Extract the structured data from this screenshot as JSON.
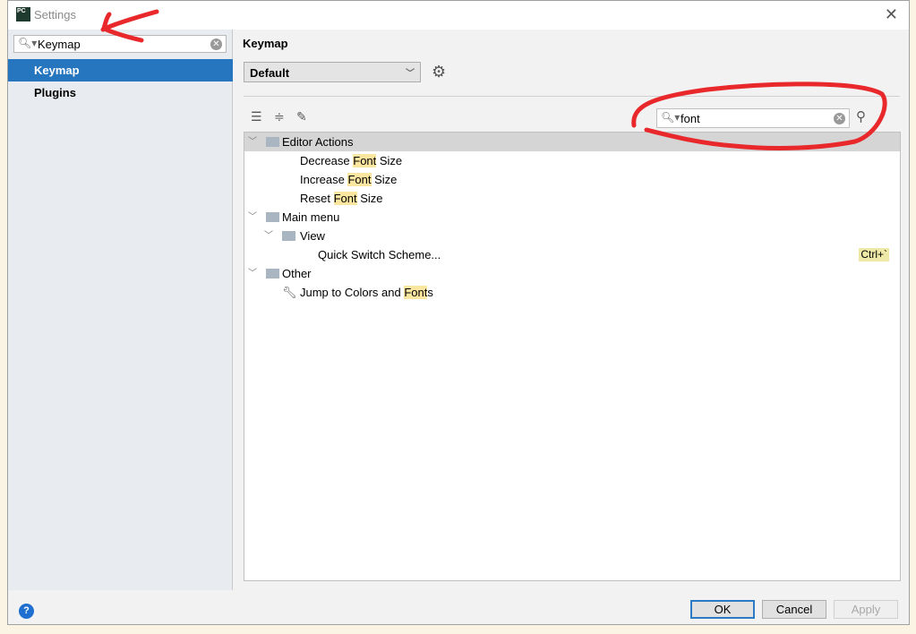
{
  "window": {
    "title": "Settings",
    "logo": "PC"
  },
  "sidebar": {
    "search_value": "Keymap",
    "items": [
      {
        "label": "Keymap",
        "selected": true
      },
      {
        "label": "Plugins",
        "selected": false
      }
    ]
  },
  "main": {
    "heading": "Keymap",
    "keymap_select": "Default",
    "filter_value": "font",
    "tree": [
      {
        "label_pre": "Editor Actions",
        "hl": "",
        "label_post": "",
        "level": 0,
        "expandable": true,
        "icon": "editor-actions-folder-icon"
      },
      {
        "label_pre": "Decrease ",
        "hl": "Font",
        "label_post": " Size",
        "level": 2
      },
      {
        "label_pre": "Increase ",
        "hl": "Font",
        "label_post": " Size",
        "level": 2
      },
      {
        "label_pre": "Reset ",
        "hl": "Font",
        "label_post": " Size",
        "level": 2
      },
      {
        "label_pre": "Main menu",
        "hl": "",
        "label_post": "",
        "level": 0,
        "expandable": true,
        "icon": "main-menu-folder-icon"
      },
      {
        "label_pre": "View",
        "hl": "",
        "label_post": "",
        "level": 1,
        "expandable": true,
        "icon": "folder-icon"
      },
      {
        "label_pre": "Quick Switch Scheme...",
        "hl": "",
        "label_post": "",
        "level": 3,
        "shortcut": "Ctrl+`"
      },
      {
        "label_pre": "Other",
        "hl": "",
        "label_post": "",
        "level": 0,
        "expandable": true,
        "icon": "other-folder-icon"
      },
      {
        "label_pre": "Jump to Colors and ",
        "hl": "Font",
        "label_post": "s",
        "level": 1,
        "icon": "wrench-icon"
      }
    ]
  },
  "footer": {
    "ok": "OK",
    "cancel": "Cancel",
    "apply": "Apply",
    "help": "?"
  },
  "colors": {
    "selection": "#2675bf",
    "highlight": "#fbe6a0",
    "annotation": "#e8282b"
  }
}
